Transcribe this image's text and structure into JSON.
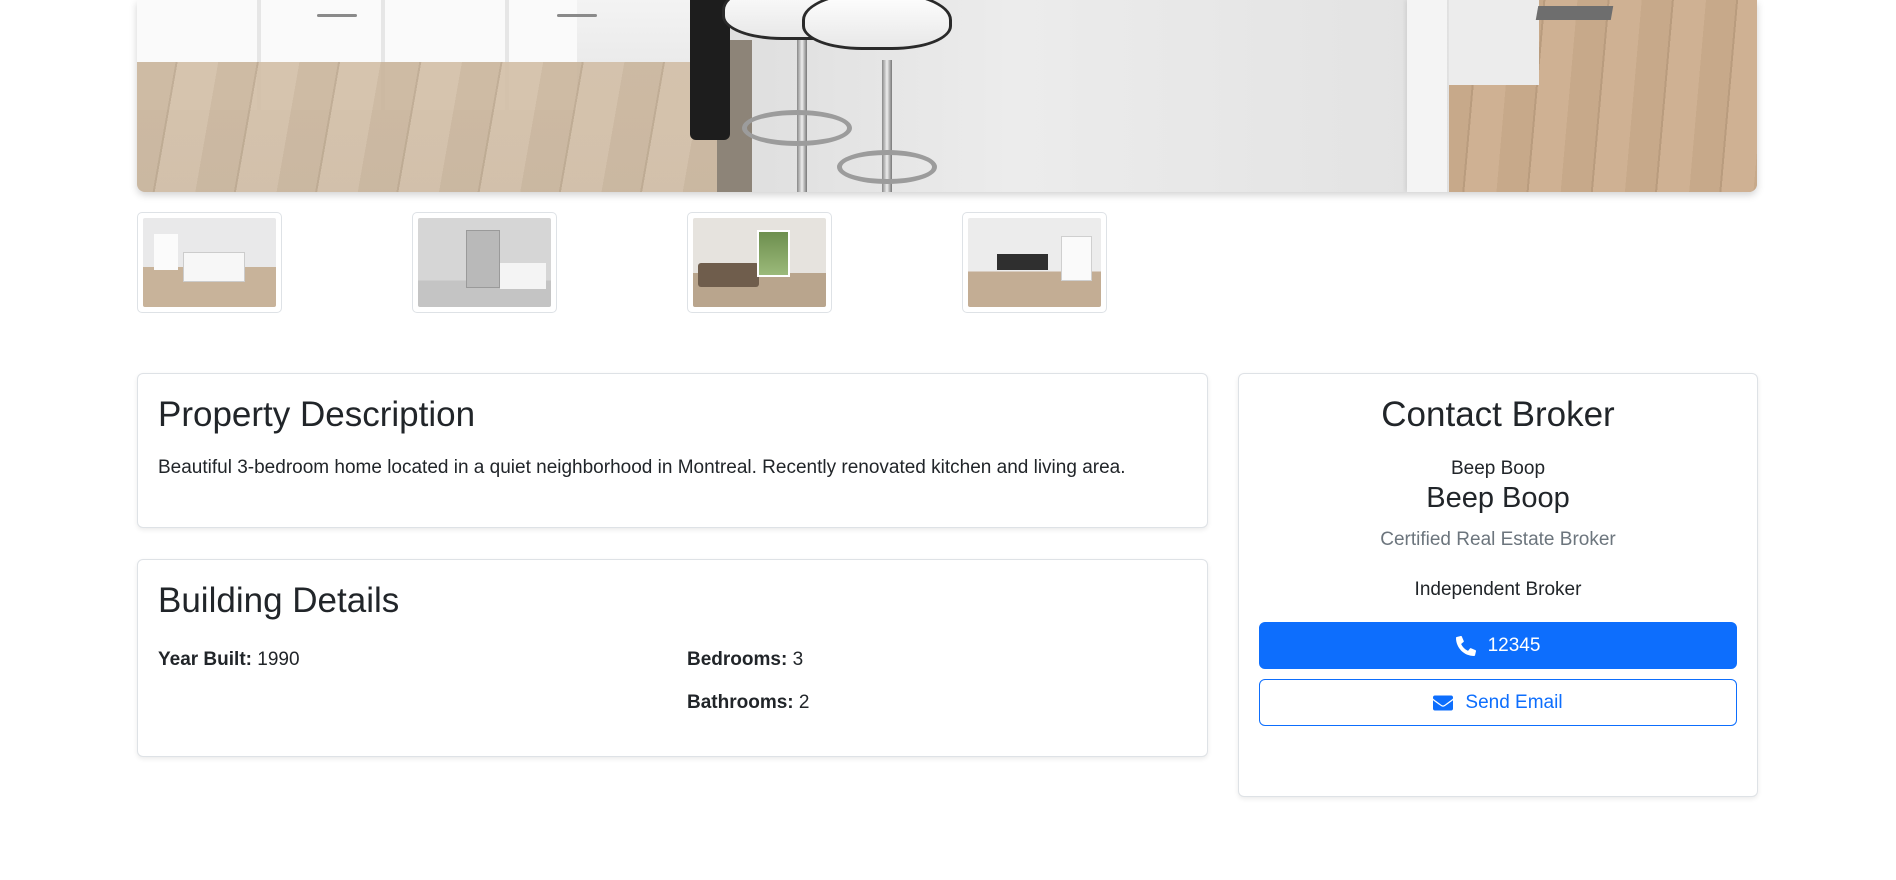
{
  "gallery": {
    "main_image": "kitchen-interior-photo",
    "thumbnails": [
      {
        "name": "kitchen-thumbnail"
      },
      {
        "name": "bathroom-thumbnail"
      },
      {
        "name": "living-room-thumbnail"
      },
      {
        "name": "dining-area-thumbnail"
      }
    ]
  },
  "description": {
    "title": "Property Description",
    "text": "Beautiful 3-bedroom home located in a quiet neighborhood in Montreal. Recently renovated kitchen and living area."
  },
  "building": {
    "title": "Building Details",
    "year_built_label": "Year Built:",
    "year_built_value": "1990",
    "bedrooms_label": "Bedrooms:",
    "bedrooms_value": "3",
    "bathrooms_label": "Bathrooms:",
    "bathrooms_value": "2"
  },
  "broker": {
    "title": "Contact Broker",
    "username": "Beep Boop",
    "name": "Beep Boop",
    "role": "Certified Real Estate Broker",
    "agency": "Independent Broker",
    "phone_label": "12345",
    "email_label": "Send Email",
    "phone_icon": "phone-icon",
    "email_icon": "envelope-icon",
    "accent_color": "#0d6efd"
  }
}
